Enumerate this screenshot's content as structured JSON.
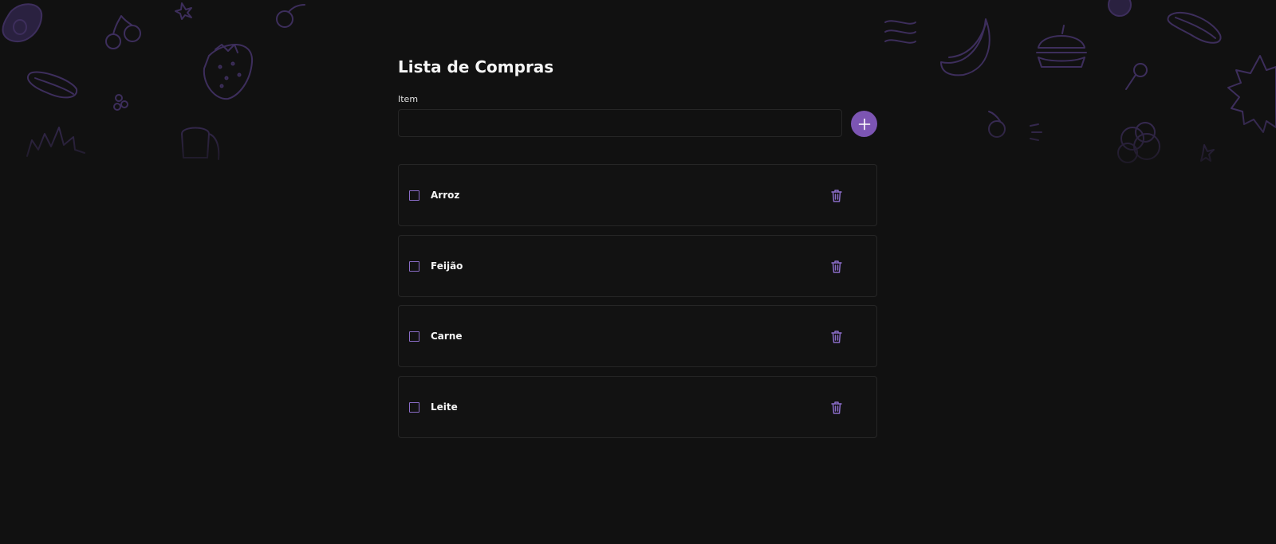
{
  "app": {
    "title": "Lista de Compras"
  },
  "form": {
    "item_label": "Item",
    "item_value": "",
    "add_icon": "plus-icon"
  },
  "items": [
    {
      "label": "Arroz",
      "checked": false
    },
    {
      "label": "Feijão",
      "checked": false
    },
    {
      "label": "Carne",
      "checked": false
    },
    {
      "label": "Leite",
      "checked": false
    }
  ],
  "colors": {
    "background": "#111111",
    "accent": "#7c55b3",
    "border": "#262626",
    "text": "#f5f5f5",
    "doodle": "#3d2e5c"
  },
  "icons": {
    "delete": "trash-icon",
    "checkbox": "checkbox-icon",
    "decor": [
      "avocado-icon",
      "cherries-icon",
      "strawberry-icon",
      "hotdog-icon",
      "bread-icon",
      "banana-icon",
      "burger-icon",
      "bacon-icon",
      "lollipop-icon",
      "donut-icon",
      "star-icon"
    ]
  }
}
